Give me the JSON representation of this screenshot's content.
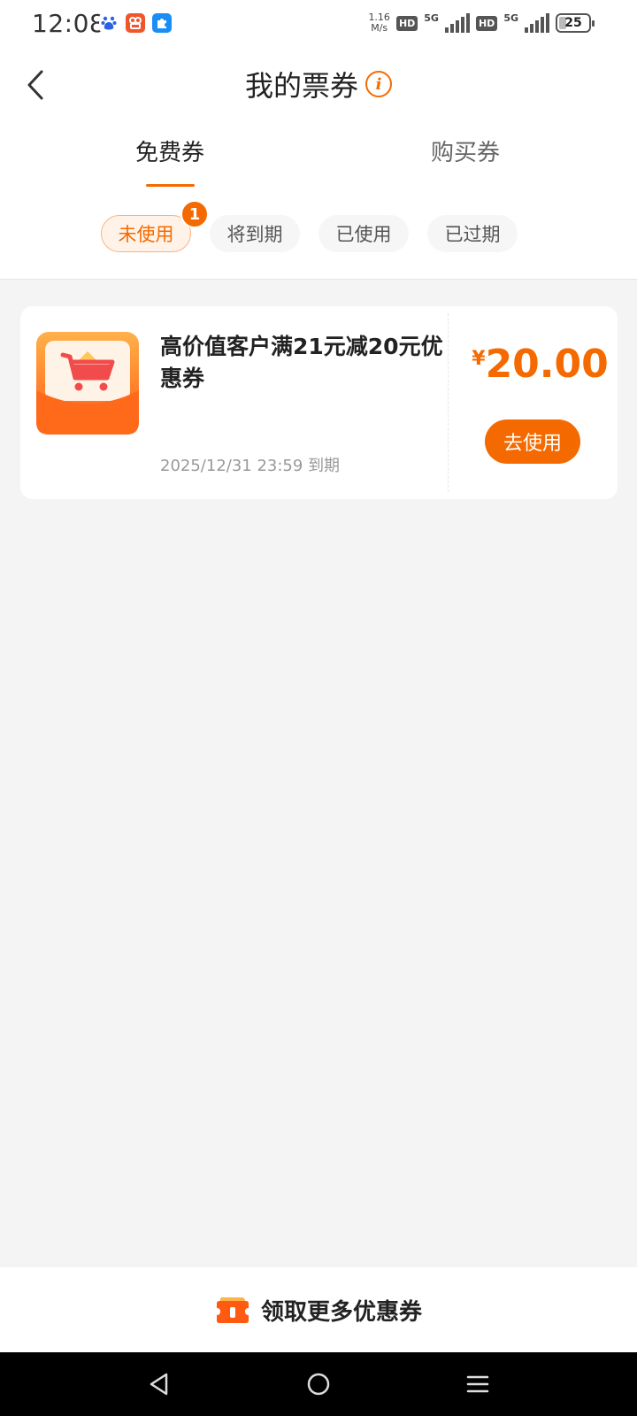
{
  "status_bar": {
    "time": "12:08",
    "net_speed_value": "1.16",
    "net_speed_unit": "M/s",
    "hd_label": "HD",
    "signal_label": "5G",
    "battery": "25"
  },
  "header": {
    "title": "我的票券",
    "tabs": [
      {
        "label": "免费券",
        "active": true
      },
      {
        "label": "购买券",
        "active": false
      }
    ],
    "filters": [
      {
        "label": "未使用",
        "active": true
      },
      {
        "label": "将到期",
        "active": false
      },
      {
        "label": "已使用",
        "active": false
      },
      {
        "label": "已过期",
        "active": false
      }
    ],
    "unused_badge": "1"
  },
  "coupons": [
    {
      "title": "高价值客户满21元减20元优惠券",
      "expiry": "2025/12/31 23:59 到期",
      "currency": "¥",
      "amount": "20.00",
      "action_label": "去使用"
    }
  ],
  "bottom_bar": {
    "label": "领取更多优惠券"
  },
  "colors": {
    "accent": "#f56a00",
    "background": "#f4f4f4"
  },
  "icons": {
    "back": "chevron-left-icon",
    "info": "info-icon",
    "coupon_thumb": "shopping-cart-icon",
    "bottom": "coupon-ticket-icon"
  }
}
